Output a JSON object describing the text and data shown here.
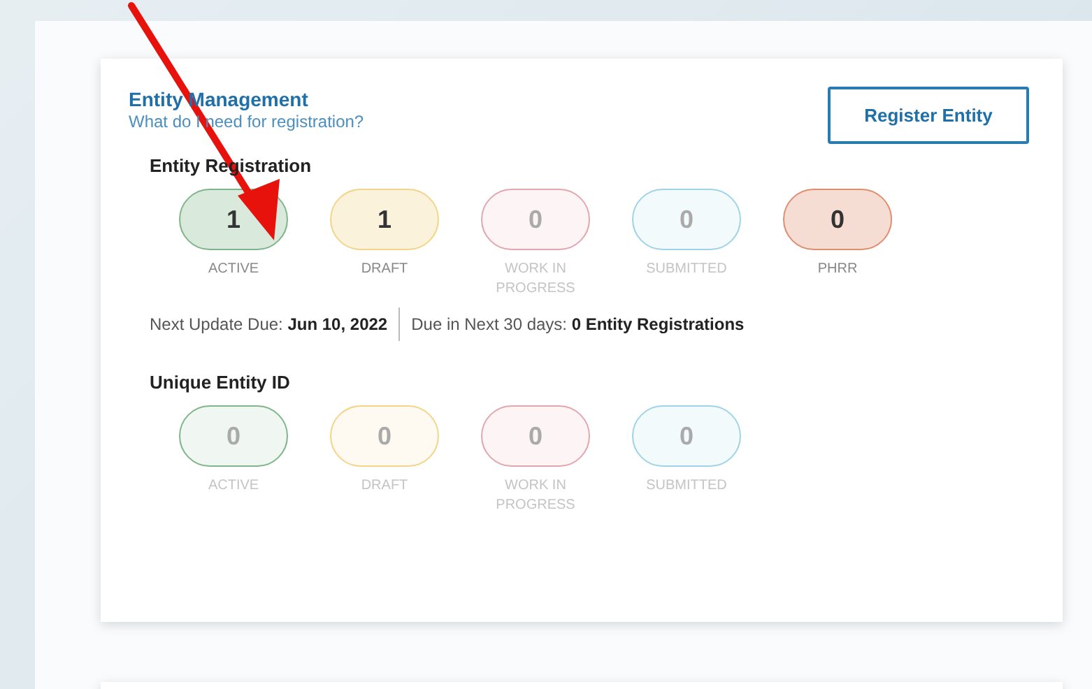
{
  "card": {
    "title": "Entity Management",
    "help_link": "What do I need for registration?",
    "register_button": "Register Entity"
  },
  "sections": [
    {
      "heading": "Entity Registration",
      "statuses": [
        {
          "count": "1",
          "label": "ACTIVE",
          "color": "#7fb58a",
          "disabled": false
        },
        {
          "count": "1",
          "label": "DRAFT",
          "color": "#f3d58a",
          "disabled": false
        },
        {
          "count": "0",
          "label": "WORK IN PROGRESS",
          "color": "#e2a6ae",
          "disabled": true
        },
        {
          "count": "0",
          "label": "SUBMITTED",
          "color": "#9fd3e6",
          "disabled": true
        },
        {
          "count": "0",
          "label": "PHRR",
          "color": "#e08c6e",
          "disabled": false
        }
      ],
      "info": [
        {
          "label": "Next Update Due:",
          "value": "Jun 10, 2022"
        },
        {
          "label": "Due in Next 30 days:",
          "value": "0 Entity Registrations"
        }
      ]
    },
    {
      "heading": "Unique Entity ID",
      "statuses": [
        {
          "count": "0",
          "label": "ACTIVE",
          "color": "#7fb58a",
          "disabled": true
        },
        {
          "count": "0",
          "label": "DRAFT",
          "color": "#f3d58a",
          "disabled": true
        },
        {
          "count": "0",
          "label": "WORK IN PROGRESS",
          "color": "#e2a6ae",
          "disabled": true
        },
        {
          "count": "0",
          "label": "SUBMITTED",
          "color": "#9fd3e6",
          "disabled": true
        }
      ]
    }
  ],
  "annotation": {
    "kind": "arrow"
  }
}
